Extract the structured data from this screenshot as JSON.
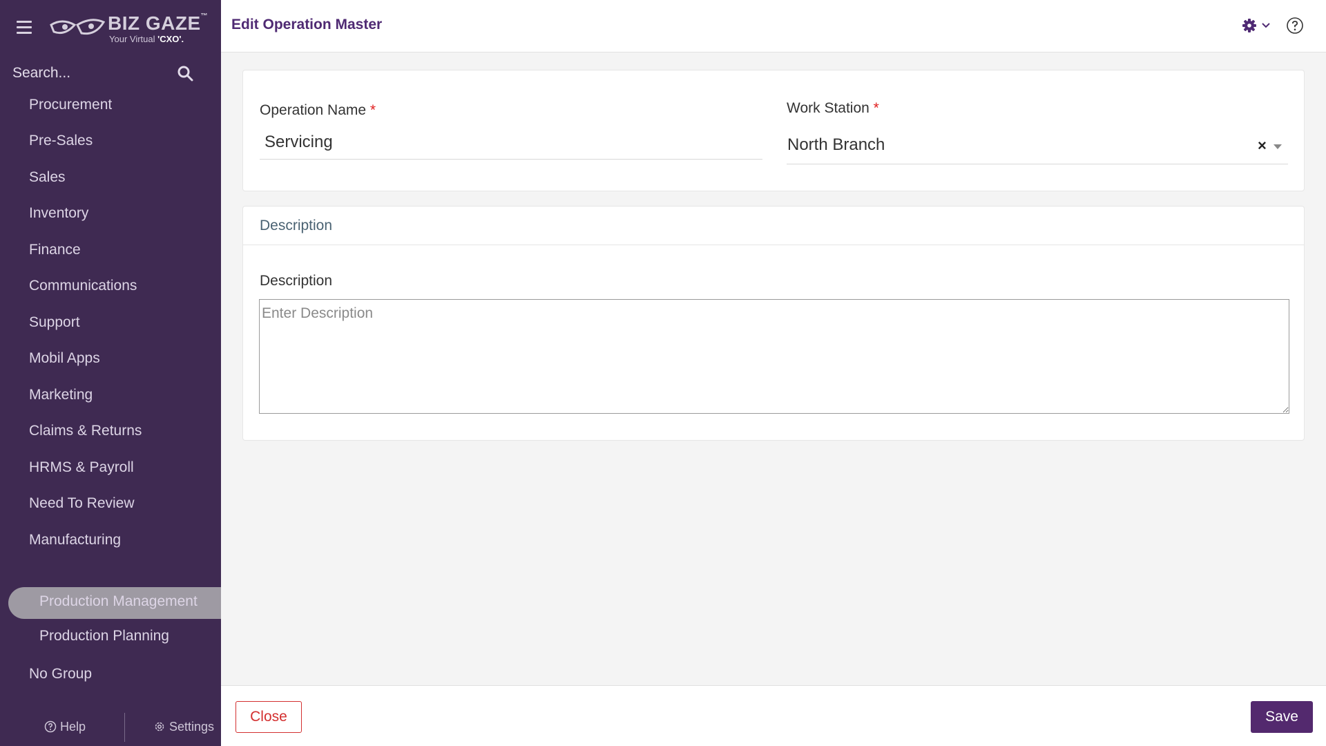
{
  "brand": {
    "name": "BIZ GAZE",
    "trademark": "™",
    "tagline_prefix": "Your Virtual",
    "tagline_emphasis": "'CXO'."
  },
  "sidebar": {
    "search_placeholder": "Search...",
    "items": [
      {
        "label": "Procurement"
      },
      {
        "label": "Pre-Sales"
      },
      {
        "label": "Sales"
      },
      {
        "label": "Inventory"
      },
      {
        "label": "Finance"
      },
      {
        "label": "Communications"
      },
      {
        "label": "Support"
      },
      {
        "label": "Mobil Apps"
      },
      {
        "label": "Marketing"
      },
      {
        "label": "Claims & Returns"
      },
      {
        "label": "HRMS & Payroll"
      },
      {
        "label": "Need To Review"
      },
      {
        "label": "Manufacturing"
      },
      {
        "label": "Production Management",
        "active": true
      },
      {
        "label": "Production Planning"
      },
      {
        "label": "No Group"
      }
    ],
    "help_label": "Help",
    "settings_label": "Settings"
  },
  "header": {
    "title": "Edit Operation Master"
  },
  "form": {
    "operation_name": {
      "label": "Operation Name",
      "required_mark": "*",
      "value": "Servicing"
    },
    "work_station": {
      "label": "Work Station",
      "required_mark": "*",
      "value": "North Branch",
      "clear_symbol": "×"
    },
    "description_section": {
      "title": "Description",
      "field_label": "Description",
      "placeholder": "Enter Description",
      "value": ""
    }
  },
  "footer": {
    "close_label": "Close",
    "save_label": "Save"
  },
  "colors": {
    "sidebar_bg": "#3f2a52",
    "accent": "#53296e",
    "required": "#e02020",
    "close": "#d32f2f"
  }
}
